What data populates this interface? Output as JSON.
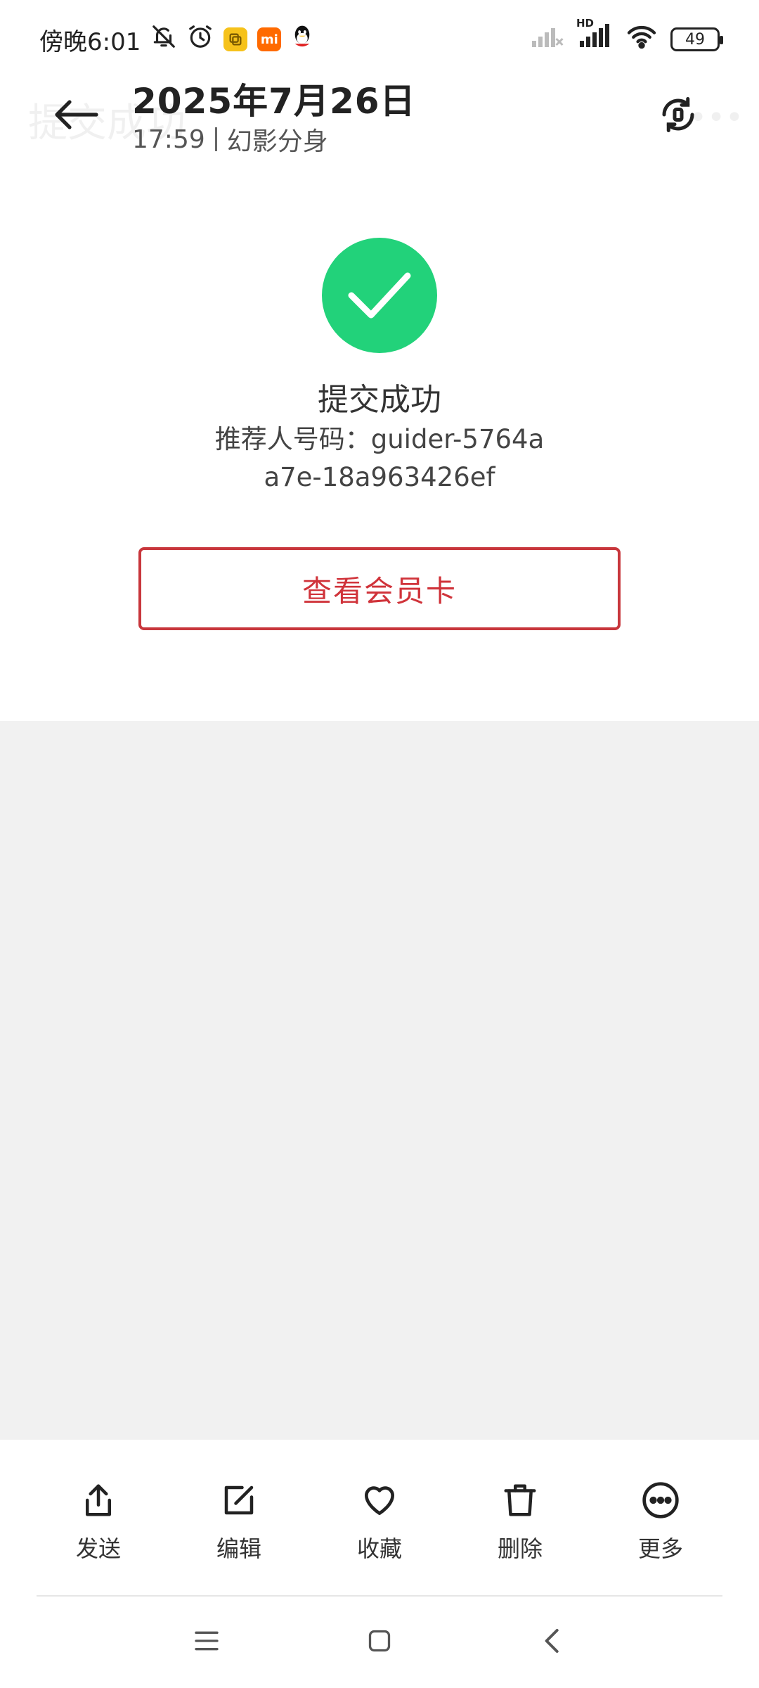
{
  "status_bar": {
    "time": "傍晚6:01",
    "battery": "49",
    "network_label": "HD",
    "icons": [
      "bell-off-icon",
      "alarm-icon",
      "app-notification-icon",
      "mi-icon",
      "qq-icon",
      "signal-weak-icon",
      "signal-icon",
      "wifi-icon",
      "battery-icon"
    ]
  },
  "header": {
    "ghost_title": "提交成功",
    "date": "2025年7月26日",
    "time": "17:59",
    "source": "幻影分身"
  },
  "result": {
    "title": "提交成功",
    "referrer_label": "推荐人号码：",
    "referrer_value": "guider-5764aa7e-18a963426ef",
    "button_label": "查看会员卡"
  },
  "colors": {
    "success_green": "#22d27a",
    "button_red": "#d0333a",
    "background_grey": "#f1f1f1"
  },
  "actions": [
    {
      "label": "发送",
      "icon": "share-icon"
    },
    {
      "label": "编辑",
      "icon": "edit-icon"
    },
    {
      "label": "收藏",
      "icon": "heart-icon"
    },
    {
      "label": "删除",
      "icon": "trash-icon"
    },
    {
      "label": "更多",
      "icon": "more-icon"
    }
  ],
  "nav": [
    "menu-icon",
    "home-icon",
    "back-icon"
  ]
}
